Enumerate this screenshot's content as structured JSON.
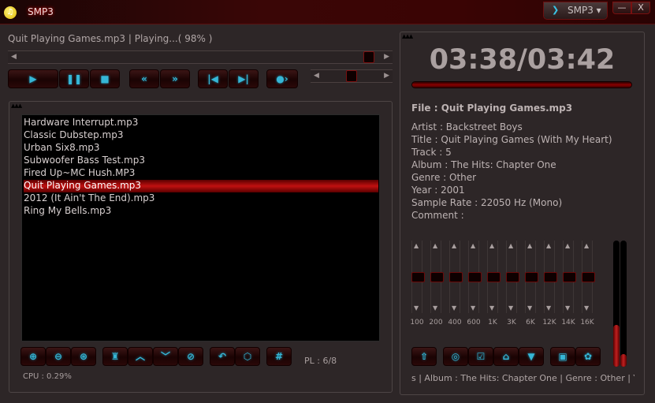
{
  "window": {
    "title": "SMP3",
    "skin_label": "SMP3",
    "minimize": "—",
    "close": "X"
  },
  "status": {
    "text": "Quit Playing Games.mp3 | Playing...( 98% )",
    "seek_percent": 98,
    "volume_percent": 50
  },
  "controls": [
    {
      "name": "play",
      "glyph": "▶"
    },
    {
      "name": "pause",
      "glyph": "❚❚"
    },
    {
      "name": "stop",
      "glyph": "■"
    },
    {
      "name": "rewind",
      "glyph": "«"
    },
    {
      "name": "fast-forward",
      "glyph": "»"
    },
    {
      "name": "previous",
      "glyph": "|◀"
    },
    {
      "name": "next",
      "glyph": "▶|"
    },
    {
      "name": "repeat",
      "glyph": "●›"
    }
  ],
  "playlist": {
    "items": [
      "Hardware Interrupt.mp3",
      "Classic Dubstep.mp3",
      "Urban Six8.mp3",
      "Subwoofer Bass Test.mp3",
      "Fired Up~MC Hush.MP3",
      "Quit Playing Games.mp3",
      "2012 (It Ain't The End).mp3",
      "Ring My Bells.mp3"
    ],
    "selected_index": 5,
    "buttons": [
      "⊕",
      "⊖",
      "⊛",
      "♜",
      "︿",
      "﹀",
      "⊘",
      "↶",
      "⬡",
      "#"
    ],
    "position": "PL : 6/8",
    "cpu": "CPU : 0.29%"
  },
  "now_playing": {
    "time": "03:38/03:42",
    "progress_percent": 98,
    "file": "File : Quit Playing Games.mp3",
    "lines": [
      "Artist : Backstreet Boys",
      "Title : Quit Playing Games (With My Heart)",
      "Track : 5",
      "Album : The Hits: Chapter One",
      "Genre : Other",
      "Year : 2001",
      "Sample Rate : 22050 Hz (Mono)",
      "Comment :"
    ],
    "ticker": "s | Album : The Hits: Chapter One | Genre : Other | Yea"
  },
  "equalizer": {
    "bands": [
      "100",
      "200",
      "400",
      "600",
      "1K",
      "3K",
      "6K",
      "12K",
      "14K",
      "16K"
    ],
    "levels_db": [
      0,
      0,
      0,
      0,
      0,
      0,
      0,
      0,
      0,
      0
    ],
    "meter_levels_percent": [
      33,
      10
    ]
  },
  "right_buttons": [
    "⇧",
    "◎",
    "☑",
    "⌂",
    "▼",
    "▣",
    "✿"
  ],
  "colors": {
    "accent": "#36b6d6",
    "highlight": "#c01010",
    "background": "#2d2627"
  }
}
